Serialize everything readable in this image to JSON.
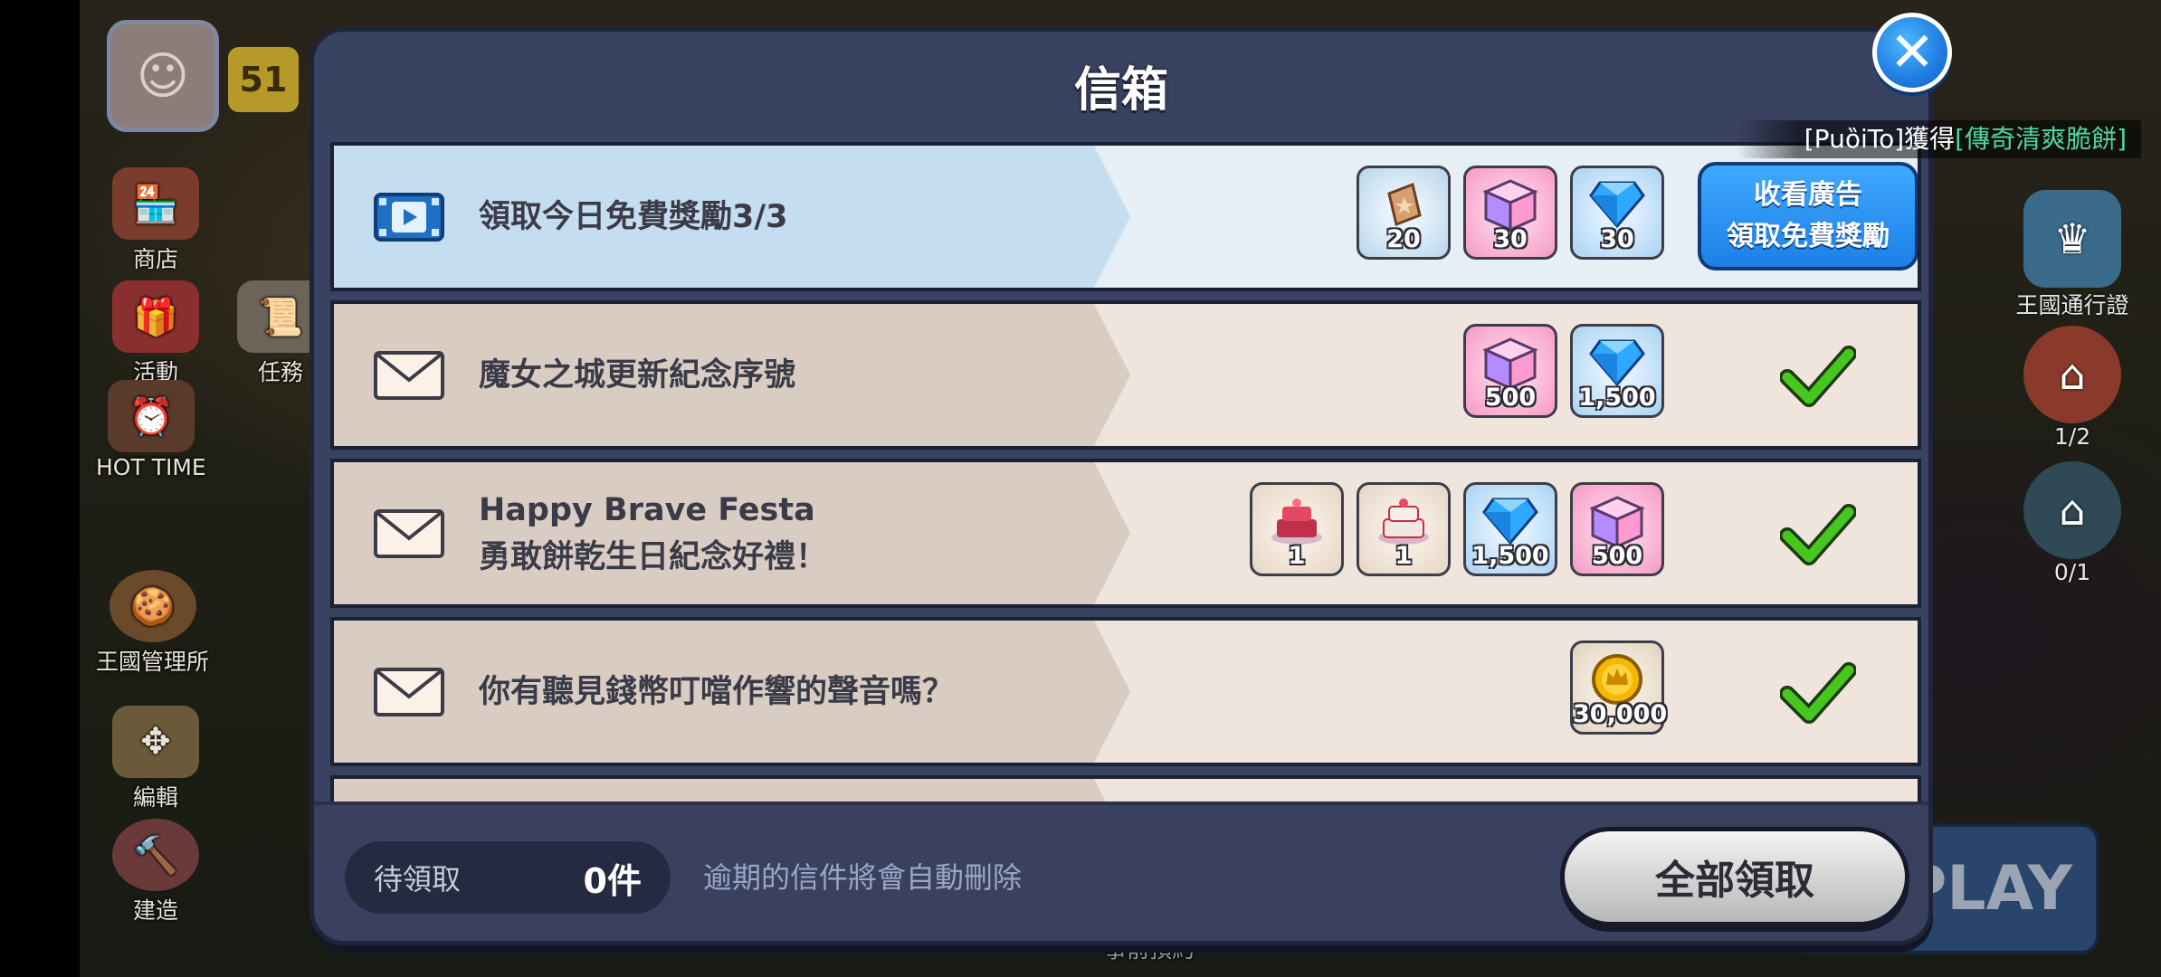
{
  "dialog": {
    "title": "信箱",
    "close_icon": "close-icon"
  },
  "ticker": {
    "player": "[PuȍiTo]",
    "verb": "獲得",
    "item": "[傳奇清爽脆餅]"
  },
  "mails": [
    {
      "type": "ad",
      "title_lines": [
        "領取今日免費獎勵3/3"
      ],
      "icon": "video-icon",
      "rewards": [
        {
          "kind": "ticket",
          "qty": "20"
        },
        {
          "kind": "cube",
          "qty": "30"
        },
        {
          "kind": "gem",
          "qty": "30"
        }
      ],
      "action": {
        "line1": "收看廣告",
        "line2": "領取免費獎勵"
      }
    },
    {
      "type": "mail",
      "title_lines": [
        "魔女之城更新紀念序號"
      ],
      "icon": "envelope-icon",
      "rewards": [
        {
          "kind": "cube",
          "qty": "500"
        },
        {
          "kind": "gem",
          "qty": "1,500"
        }
      ],
      "claimed": true
    },
    {
      "type": "mail",
      "title_lines": [
        "Happy Brave Festa",
        "勇敢餅乾生日紀念好禮！"
      ],
      "icon": "envelope-icon",
      "rewards": [
        {
          "kind": "cake",
          "qty": "1"
        },
        {
          "kind": "cake",
          "qty": "1"
        },
        {
          "kind": "gem",
          "qty": "1,500"
        },
        {
          "kind": "cube",
          "qty": "500"
        }
      ],
      "claimed": true
    },
    {
      "type": "mail",
      "title_lines": [
        "你有聽見錢幣叮噹作響的聲音嗎？"
      ],
      "icon": "envelope-icon",
      "rewards": [
        {
          "kind": "coin",
          "qty": "30,000"
        }
      ],
      "claimed": true
    }
  ],
  "footer": {
    "pending_label": "待領取",
    "pending_count": "0件",
    "notice": "逾期的信件將會自動刪除",
    "claim_all": "全部領取"
  },
  "background": {
    "level": "51",
    "left_menu": [
      "商店",
      "活動",
      "任務",
      "HOT TIME",
      "王國管理所",
      "編輯",
      "建造"
    ],
    "right_menu": {
      "pass": "王國通行證",
      "slot1": "1/2",
      "slot2": "0/1"
    },
    "play": "PLAY",
    "bottom_hint": "事前預約"
  },
  "colors": {
    "dialog_bg": "#3a4261",
    "accent_blue": "#1d7fe6",
    "check_green": "#3fbf1a",
    "ticker_highlight": "#4fd6a3"
  }
}
